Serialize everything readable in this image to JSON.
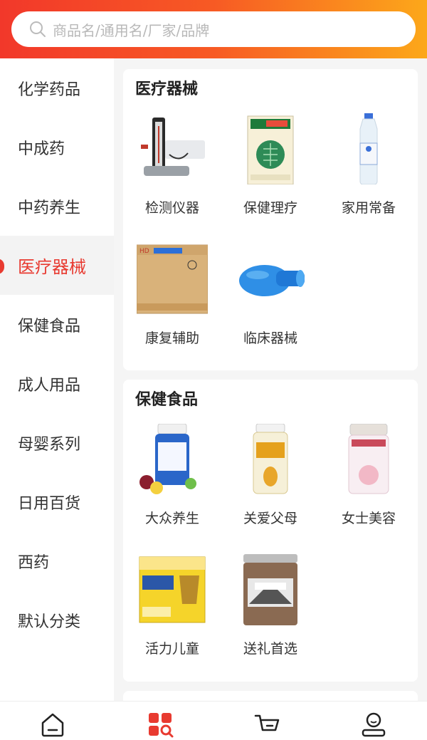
{
  "search": {
    "placeholder": "商品名/通用名/厂家/品牌",
    "icon": "search-icon"
  },
  "sidebar": {
    "items": [
      {
        "label": "化学药品"
      },
      {
        "label": "中成药"
      },
      {
        "label": "中药养生"
      },
      {
        "label": "医疗器械",
        "active": true
      },
      {
        "label": "保健食品"
      },
      {
        "label": "成人用品"
      },
      {
        "label": "母婴系列"
      },
      {
        "label": "日用百货"
      },
      {
        "label": "西药"
      },
      {
        "label": "默认分类"
      }
    ]
  },
  "sections": [
    {
      "title": "医疗器械",
      "items": [
        {
          "label": "检测仪器",
          "image": "blood-pressure-monitor"
        },
        {
          "label": "保健理疗",
          "image": "therapy-box"
        },
        {
          "label": "家用常备",
          "image": "saline-bottle"
        },
        {
          "label": "康复辅助",
          "image": "cardboard-box"
        },
        {
          "label": "临床器械",
          "image": "blue-urinal"
        }
      ]
    },
    {
      "title": "保健食品",
      "items": [
        {
          "label": "大众养生",
          "image": "vitamin-bottle"
        },
        {
          "label": "关爱父母",
          "image": "lecithin-bottle"
        },
        {
          "label": "女士美容",
          "image": "collagen-bottle"
        },
        {
          "label": "活力儿童",
          "image": "probiotic-box"
        },
        {
          "label": "送礼首选",
          "image": "dandelion-jar"
        }
      ]
    }
  ],
  "bottom_nav": [
    {
      "icon": "home-icon",
      "active": false
    },
    {
      "icon": "category-icon",
      "active": true
    },
    {
      "icon": "cart-icon",
      "active": false
    },
    {
      "icon": "profile-icon",
      "active": false
    }
  ],
  "colors": {
    "accent": "#e83a30",
    "header_start": "#f2382a",
    "header_end": "#fca81a"
  }
}
